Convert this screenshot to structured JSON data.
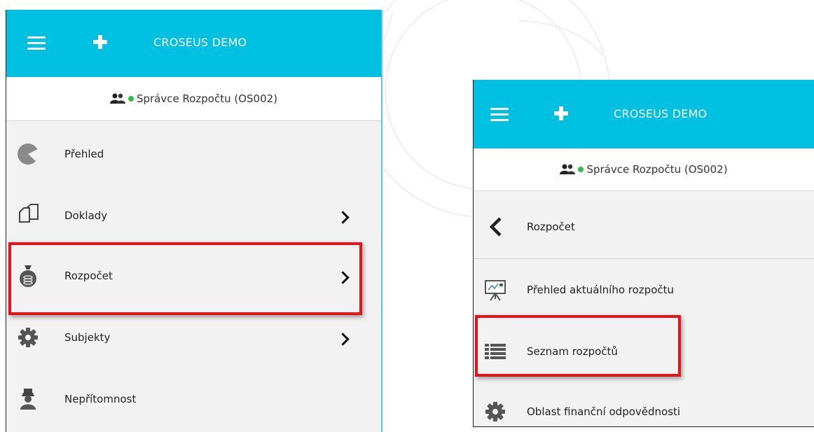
{
  "panel_left": {
    "header": {
      "title": "CROSEUS DEMO",
      "menu_icon": "hamburger-icon",
      "add_icon": "plus-icon"
    },
    "role": {
      "label": "Správce Rozpočtu (OS002)",
      "icon": "users-icon",
      "status_color": "#2fbd4e"
    },
    "items": [
      {
        "label": "Přehled",
        "icon": "pie-chart-icon"
      },
      {
        "label": "Doklady",
        "icon": "documents-icon",
        "chevron": true
      },
      {
        "label": "Rozpočet",
        "icon": "money-bag-icon",
        "chevron": true,
        "highlighted": true
      },
      {
        "label": "Subjekty",
        "icon": "gear-icon",
        "chevron": true
      },
      {
        "label": "Nepřítomnost",
        "icon": "absence-icon"
      }
    ]
  },
  "panel_right": {
    "header": {
      "title": "CROSEUS DEMO",
      "menu_icon": "hamburger-icon",
      "add_icon": "plus-icon"
    },
    "role": {
      "label": "Správce Rozpočtu (OS002)",
      "icon": "users-icon",
      "status_color": "#2fbd4e"
    },
    "back": {
      "label": "Rozpočet",
      "icon": "chevron-left-icon"
    },
    "items": [
      {
        "label": "Přehled aktuálního rozpočtu",
        "icon": "presentation-chart-icon"
      },
      {
        "label": "Seznam rozpočtů",
        "icon": "list-icon",
        "highlighted": true
      },
      {
        "label": "Oblast finanční odpovědnosti",
        "icon": "gear-icon"
      }
    ]
  },
  "colors": {
    "header": "#00c0e2",
    "highlight": "#e3141b",
    "panel_bg": "#f2f2f2"
  }
}
